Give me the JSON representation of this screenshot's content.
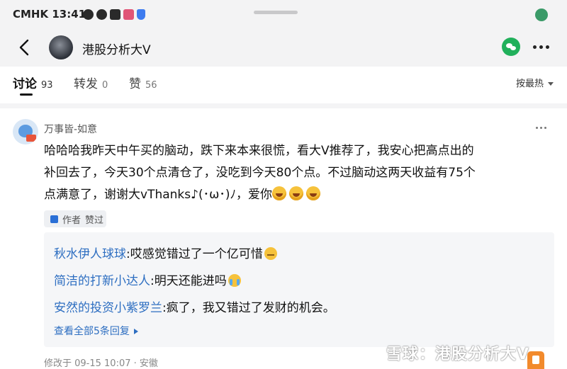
{
  "status_bar": {
    "carrier_time": "CMHK 13:41",
    "icons": [
      "facebook-icon",
      "facebook-icon",
      "clock-icon",
      "chart-app-icon",
      "shield-icon"
    ]
  },
  "header": {
    "back_icon": "back-arrow-icon",
    "title": "港股分析大V",
    "share_icon": "wechat-icon",
    "more_icon": "more-icon"
  },
  "tabs": [
    {
      "label": "讨论",
      "count": "93"
    },
    {
      "label": "转发",
      "count": "0"
    },
    {
      "label": "赞",
      "count": "56"
    }
  ],
  "sort": {
    "label": "按最热"
  },
  "comment": {
    "user": "万事皆-如意",
    "text_line1": "哈哈哈我昨天中午买的脑动，跌下来本来很慌，看大V推荐了，我安心把高点出的",
    "text_line2": "补回去了，今天30个点清仓了，没吃到今天80个点。不过脑动这两天收益有75个",
    "text_line3": "点满意了，谢谢大vThanks♪(･ω･)ﾉ，爱你",
    "liked_badge": {
      "prefix": "作者",
      "label": "赞过"
    },
    "replies": [
      {
        "name": "秋水伊人球球",
        "sep": ":",
        "text": "哎感觉错过了一个亿可惜"
      },
      {
        "name": "简洁的打新小达人",
        "sep": ":",
        "text": "明天还能进吗"
      },
      {
        "name": "安然的投资小紫罗兰",
        "sep": ":",
        "text": "疯了，我又错过了发财的机会。"
      }
    ],
    "view_all": "查看全部5条回复",
    "meta": "修改于 09-15 10:07 · 安徽"
  },
  "watermark": "雪球：港股分析大V",
  "colors": {
    "link": "#2d6ec1",
    "wechat": "#21b05b",
    "accent_orange": "#f28a2c"
  }
}
